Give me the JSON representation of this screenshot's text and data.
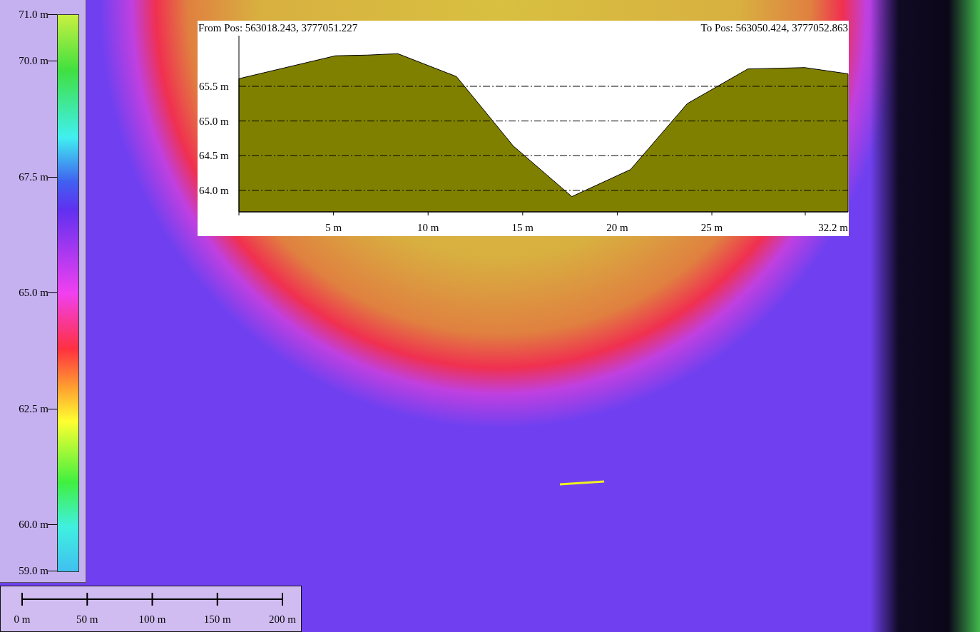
{
  "legend": {
    "labels": [
      "71.0 m",
      "70.0 m",
      "67.5 m",
      "65.0 m",
      "62.5 m",
      "60.0 m",
      "59.0 m"
    ]
  },
  "profile": {
    "from_label": "From Pos: 563018.243, 3777051.227",
    "to_label": "To Pos: 563050.424, 3777052.863",
    "chart_data": {
      "type": "area",
      "x": [
        0,
        5.1,
        6.8,
        8.4,
        11.5,
        14.5,
        17.6,
        20.7,
        23.7,
        26.9,
        28.5,
        29.9,
        32.2
      ],
      "series": [
        {
          "color": "#808000",
          "values": [
            65.61,
            65.94,
            65.95,
            65.97,
            65.64,
            64.64,
            63.91,
            64.3,
            65.25,
            65.75,
            65.76,
            65.77,
            65.68
          ]
        }
      ],
      "xlim": [
        0,
        32.2
      ],
      "ylim": [
        63.69,
        66.23
      ],
      "grid": true,
      "xticks": [
        {
          "value": 5,
          "label": "5 m"
        },
        {
          "value": 10,
          "label": "10 m"
        },
        {
          "value": 15,
          "label": "15 m"
        },
        {
          "value": 20,
          "label": "20 m"
        },
        {
          "value": 25,
          "label": "25 m"
        },
        {
          "value": 32.2,
          "label": "32.2 m"
        }
      ],
      "yticks": [
        {
          "value": 64,
          "label": "64.0 m"
        },
        {
          "value": 64.5,
          "label": "64.5 m"
        },
        {
          "value": 65,
          "label": "65.0 m"
        },
        {
          "value": 65.5,
          "label": "65.5 m"
        }
      ]
    }
  },
  "scale_bar": {
    "labels": [
      "0 m",
      "50 m",
      "100 m",
      "150 m",
      "200 m"
    ]
  }
}
